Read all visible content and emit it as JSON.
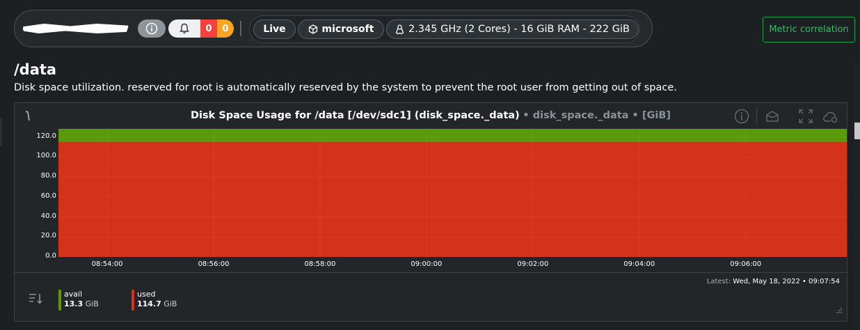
{
  "topbar": {
    "alarms": {
      "critical": "0",
      "warning": "0"
    },
    "live_label": "Live",
    "space_label": "microsoft",
    "hardware_label": "2.345 GHz (2 Cores) - 16 GiB RAM - 222 GiB"
  },
  "metric_correlation_label": "Metric correlation",
  "section": {
    "title": "/data",
    "description": "Disk space utilization. reserved for root is automatically reserved by the system to prevent the root user from getting out of space."
  },
  "chart_header": {
    "title": "Disk Space Usage for /data [/dev/sdc1] (disk_space._data)",
    "context": "• disk_space._data • [GiB]"
  },
  "legend": {
    "latest_label": "Latest:",
    "latest_value": "Wed, May 18, 2022 • 09:07:54",
    "items": [
      {
        "name": "avail",
        "value": "13.3",
        "unit": "GiB",
        "color": "#5a9a0a"
      },
      {
        "name": "used",
        "value": "114.7",
        "unit": "GiB",
        "color": "#d43219"
      }
    ]
  },
  "colors": {
    "accent_green": "#27c25e",
    "used": "#d43219",
    "avail": "#5a9a0a"
  },
  "chart_data": {
    "type": "area",
    "stacked": true,
    "title": "Disk Space Usage for /data [/dev/sdc1] (disk_space._data)",
    "ylabel": "",
    "unit": "GiB",
    "ylim": [
      0,
      128
    ],
    "yticks": [
      "0.0",
      "20.0",
      "40.0",
      "60.0",
      "80.0",
      "100.0",
      "120.0"
    ],
    "xticks": [
      "08:54:00",
      "08:56:00",
      "08:58:00",
      "09:00:00",
      "09:02:00",
      "09:04:00",
      "09:06:00"
    ],
    "x_range": [
      "08:53:05",
      "09:07:54"
    ],
    "series": [
      {
        "name": "used",
        "values": [
          114.7,
          114.7
        ],
        "color": "#d43219"
      },
      {
        "name": "avail",
        "values": [
          13.3,
          13.3
        ],
        "color": "#5a9a0a"
      }
    ],
    "grid": true
  }
}
